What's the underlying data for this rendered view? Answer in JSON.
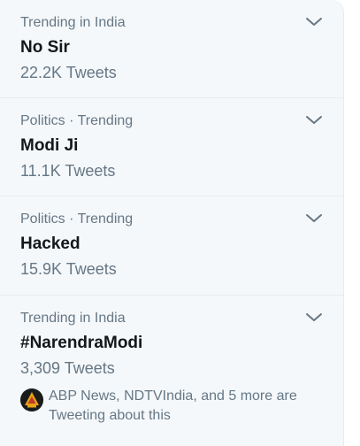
{
  "trends": [
    {
      "context": "Trending in India",
      "name": "No Sir",
      "count": "22.2K Tweets"
    },
    {
      "context": "Politics · Trending",
      "name": "Modi Ji",
      "count": "11.1K Tweets"
    },
    {
      "context": "Politics · Trending",
      "name": "Hacked",
      "count": "15.9K Tweets"
    },
    {
      "context": "Trending in India",
      "name": "#NarendraModi",
      "count": "3,309 Tweets",
      "tweeting": "ABP News, NDTVIndia, and 5 more are Tweeting about this"
    }
  ],
  "colors": {
    "panel_bg": "#f5f8fa",
    "text_primary": "#14171a",
    "text_secondary": "#657786",
    "divider": "#e6ecf0"
  },
  "icons": {
    "more": "chevron-down-icon",
    "avatar": "abp-news-logo"
  }
}
